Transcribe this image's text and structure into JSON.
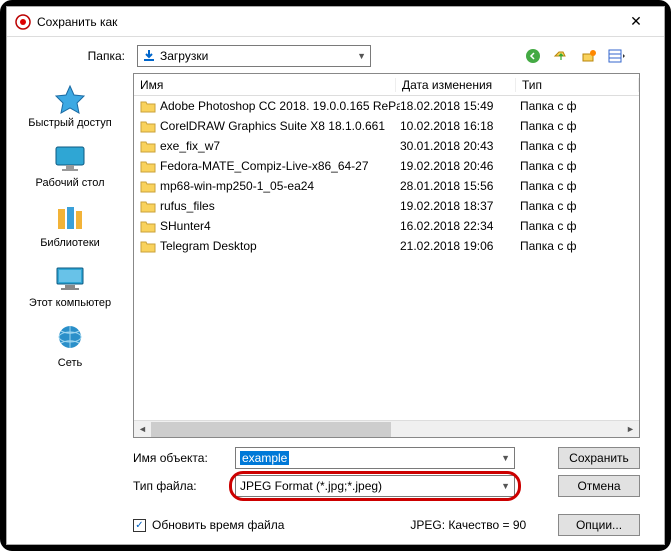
{
  "window": {
    "title": "Сохранить как"
  },
  "toprow": {
    "label": "Папка:",
    "folder": "Загрузки"
  },
  "sidebar": [
    {
      "id": "quick",
      "label": "Быстрый доступ"
    },
    {
      "id": "desktop",
      "label": "Рабочий стол"
    },
    {
      "id": "libraries",
      "label": "Библиотеки"
    },
    {
      "id": "computer",
      "label": "Этот компьютер"
    },
    {
      "id": "network",
      "label": "Сеть"
    }
  ],
  "columns": {
    "name": "Имя",
    "date": "Дата изменения",
    "type": "Тип"
  },
  "files": [
    {
      "name": "Adobe Photoshop CC 2018. 19.0.0.165 RePa...",
      "date": "18.02.2018 15:49",
      "type": "Папка с ф"
    },
    {
      "name": "CorelDRAW Graphics Suite X8 18.1.0.661",
      "date": "10.02.2018 16:18",
      "type": "Папка с ф"
    },
    {
      "name": "exe_fix_w7",
      "date": "30.01.2018 20:43",
      "type": "Папка с ф"
    },
    {
      "name": "Fedora-MATE_Compiz-Live-x86_64-27",
      "date": "19.02.2018 20:46",
      "type": "Папка с ф"
    },
    {
      "name": "mp68-win-mp250-1_05-ea24",
      "date": "28.01.2018 15:56",
      "type": "Папка с ф"
    },
    {
      "name": "rufus_files",
      "date": "19.02.2018 18:37",
      "type": "Папка с ф"
    },
    {
      "name": "SHunter4",
      "date": "16.02.2018 22:34",
      "type": "Папка с ф"
    },
    {
      "name": "Telegram Desktop",
      "date": "21.02.2018 19:06",
      "type": "Папка с ф"
    }
  ],
  "form": {
    "filename_label": "Имя объекта:",
    "filename_value": "example",
    "filetype_label": "Тип файла:",
    "filetype_value": "JPEG Format (*.jpg;*.jpeg)",
    "save": "Сохранить",
    "cancel": "Отмена",
    "options": "Опции..."
  },
  "status": {
    "checkbox_label": "Обновить время файла",
    "quality": "JPEG: Качество = 90"
  }
}
